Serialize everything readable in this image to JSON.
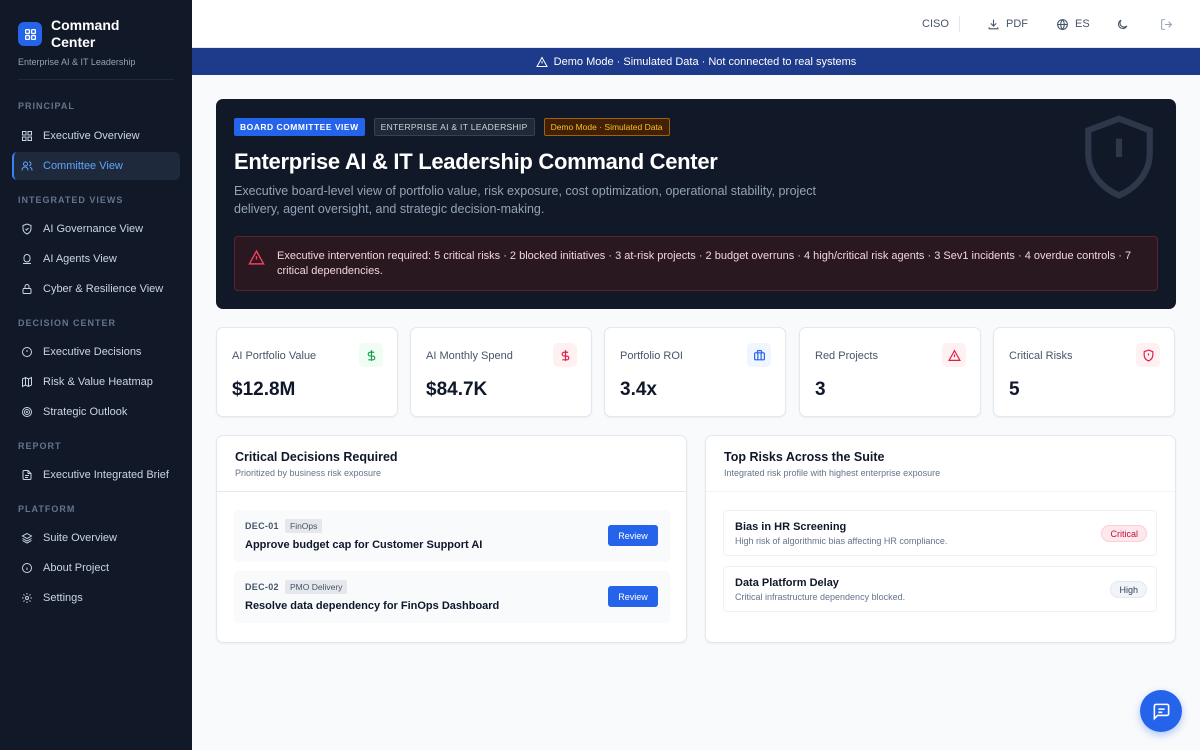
{
  "brand": {
    "title": "Command Center",
    "subtitle": "Enterprise AI & IT Leadership"
  },
  "sidebar": {
    "sections": [
      {
        "label": "PRINCIPAL",
        "items": [
          {
            "label": "Executive Overview",
            "icon": "grid-icon"
          },
          {
            "label": "Committee View",
            "icon": "users-icon",
            "active": true
          }
        ]
      },
      {
        "label": "INTEGRATED VIEWS",
        "items": [
          {
            "label": "AI Governance View",
            "icon": "shield-icon"
          },
          {
            "label": "AI Agents View",
            "icon": "bot-icon"
          },
          {
            "label": "Cyber & Resilience View",
            "icon": "lock-icon"
          }
        ]
      },
      {
        "label": "DECISION CENTER",
        "items": [
          {
            "label": "Executive Decisions",
            "icon": "alert-circle-icon"
          },
          {
            "label": "Risk & Value Heatmap",
            "icon": "map-icon"
          },
          {
            "label": "Strategic Outlook",
            "icon": "target-icon"
          }
        ]
      },
      {
        "label": "REPORT",
        "items": [
          {
            "label": "Executive Integrated Brief",
            "icon": "file-icon"
          }
        ]
      },
      {
        "label": "PLATFORM",
        "items": [
          {
            "label": "Suite Overview",
            "icon": "layers-icon"
          },
          {
            "label": "About Project",
            "icon": "info-icon"
          },
          {
            "label": "Settings",
            "icon": "gear-icon"
          }
        ]
      }
    ]
  },
  "topbar": {
    "role": "CISO",
    "pdf_label": "PDF",
    "language_label": "ES"
  },
  "demo_banner": "Demo Mode · Simulated Data · Not connected to real systems",
  "hero": {
    "tags": [
      "BOARD COMMITTEE VIEW",
      "ENTERPRISE AI & IT LEADERSHIP",
      "Demo Mode · Simulated Data"
    ],
    "title": "Enterprise AI & IT Leadership Command Center",
    "description": "Executive board-level view of portfolio value, risk exposure, cost optimization, operational stability, project delivery, agent oversight, and strategic decision-making.",
    "alert": "Executive intervention required: 5 critical risks · 2 blocked initiatives · 3 at-risk projects · 2 budget overruns · 4 high/critical risk agents · 3 Sev1 incidents · 4 overdue controls · 7 critical dependencies."
  },
  "kpis": [
    {
      "label": "AI Portfolio Value",
      "value": "$12.8M",
      "icon": "dollar-icon",
      "color": "#16a34a",
      "bg": "#f0fdf4"
    },
    {
      "label": "AI Monthly Spend",
      "value": "$84.7K",
      "icon": "dollar-icon",
      "color": "#e11d48",
      "bg": "#fff1f2"
    },
    {
      "label": "Portfolio ROI",
      "value": "3.4x",
      "icon": "briefcase-icon",
      "color": "#2563eb",
      "bg": "#eff6ff"
    },
    {
      "label": "Red Projects",
      "value": "3",
      "icon": "warning-icon",
      "color": "#e11d48",
      "bg": "#fff1f2"
    },
    {
      "label": "Critical Risks",
      "value": "5",
      "icon": "shield-alert-icon",
      "color": "#e11d48",
      "bg": "#fff1f2"
    }
  ],
  "decisions": {
    "title": "Critical Decisions Required",
    "subtitle": "Prioritized by business risk exposure",
    "items": [
      {
        "id": "DEC-01",
        "tag": "FinOps",
        "title": "Approve budget cap for Customer Support AI",
        "action": "Review"
      },
      {
        "id": "DEC-02",
        "tag": "PMO Delivery",
        "title": "Resolve data dependency for FinOps Dashboard",
        "action": "Review"
      }
    ]
  },
  "risks": {
    "title": "Top Risks Across the Suite",
    "subtitle": "Integrated risk profile with highest enterprise exposure",
    "items": [
      {
        "title": "Bias in HR Screening",
        "description": "High risk of algorithmic bias affecting HR compliance.",
        "severity": "Critical"
      },
      {
        "title": "Data Platform Delay",
        "description": "Critical infrastructure dependency blocked.",
        "severity": "High"
      }
    ]
  }
}
